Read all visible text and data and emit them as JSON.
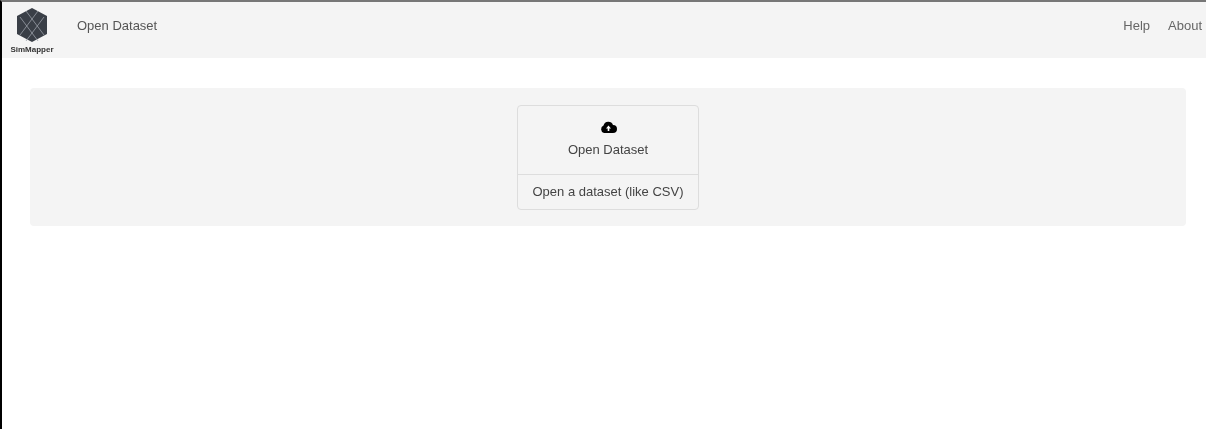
{
  "navbar": {
    "logo_text": "SimMapper",
    "title": "Open Dataset",
    "links": [
      "Help",
      "About"
    ]
  },
  "card": {
    "title": "Open Dataset",
    "footer": "Open a dataset (like CSV)"
  }
}
